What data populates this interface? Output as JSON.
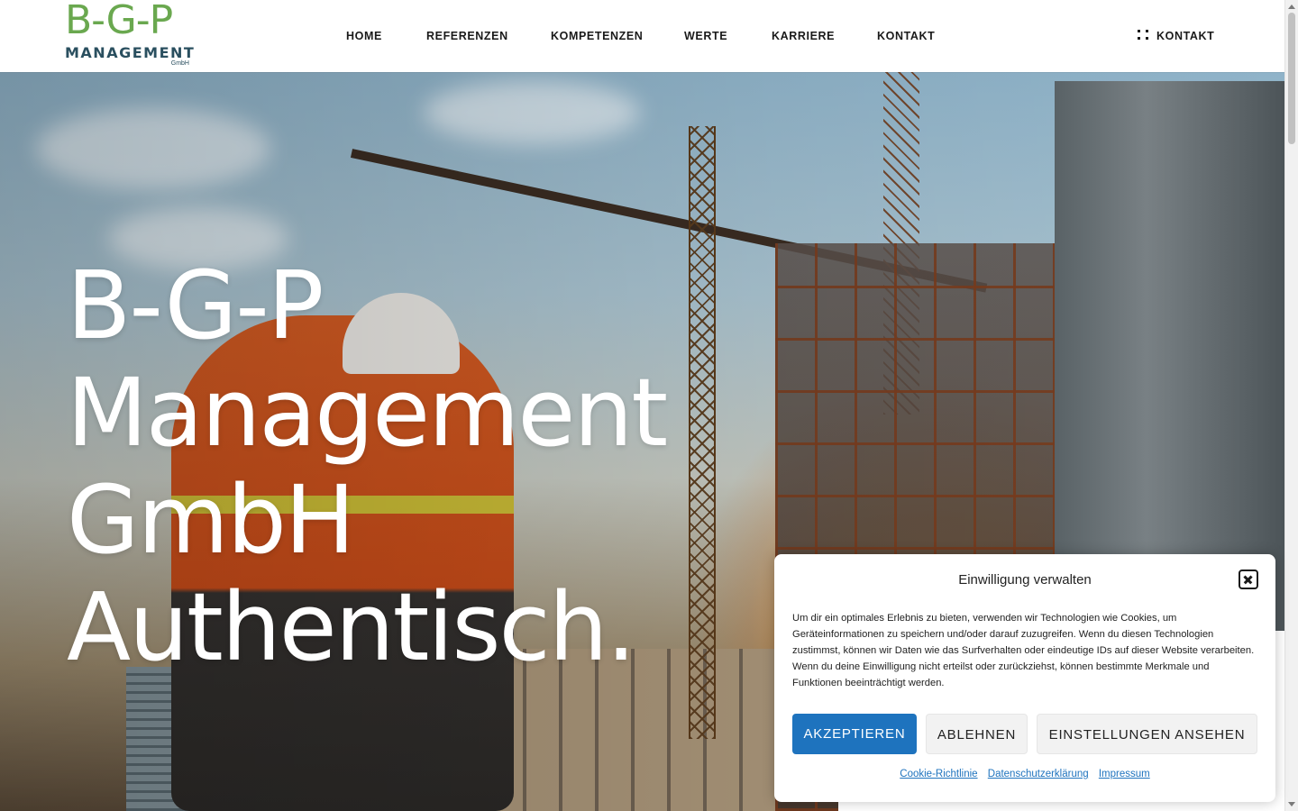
{
  "logo": {
    "top": "B-G-P",
    "bottom": "MANAGEMENT",
    "suffix": "GmbH"
  },
  "nav": {
    "items": [
      "HOME",
      "REFERENZEN",
      "KOMPETENZEN",
      "WERTE",
      "KARRIERE",
      "KONTAKT"
    ]
  },
  "header_cta": {
    "label": "KONTAKT",
    "icon": "grid-dots-icon"
  },
  "hero": {
    "title_lines": [
      "B-G-P",
      "Management",
      "GmbH",
      "Authentisch."
    ],
    "image": "construction-worker-with-cranes"
  },
  "consent": {
    "title": "Einwilligung verwalten",
    "text": "Um dir ein optimales Erlebnis zu bieten, verwenden wir Technologien wie Cookies, um Geräteinformationen zu speichern und/oder darauf zuzugreifen. Wenn du diesen Technologien zustimmst, können wir Daten wie das Surfverhalten oder eindeutige IDs auf dieser Website verarbeiten. Wenn du deine Einwilligung nicht erteilst oder zurückziehst, können bestimmte Merkmale und Funktionen beeinträchtigt werden.",
    "accept_label": "AKZEPTIEREN",
    "deny_label": "ABLEHNEN",
    "preferences_label": "EINSTELLUNGEN ANSEHEN",
    "links": [
      "Cookie-Richtlinie",
      "Datenschutzerklärung",
      "Impressum"
    ]
  },
  "colors": {
    "brand_green": "#6aa84f",
    "brand_dark": "#2a4f5f",
    "accent_blue": "#1e73be"
  }
}
